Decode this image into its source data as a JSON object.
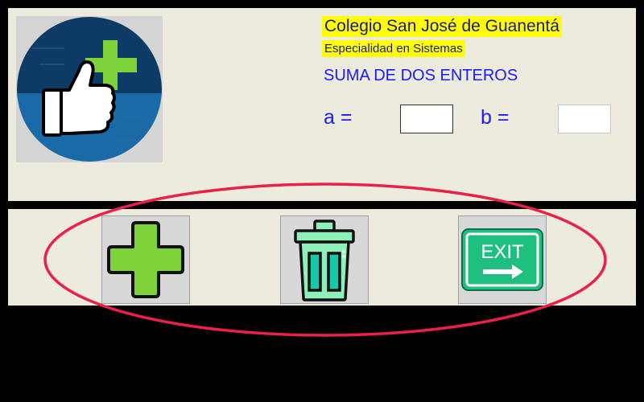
{
  "header": {
    "title": "Colegio San José de Guanentá",
    "subtitle": "Especialidad en Sistemas",
    "heading": "SUMA DE DOS ENTEROS"
  },
  "form": {
    "a_label": "a =",
    "a_value": "",
    "b_label": "b =",
    "b_value": ""
  },
  "toolbar": {
    "buttons": [
      {
        "icon": "plus-icon",
        "action": "sum"
      },
      {
        "icon": "trash-icon",
        "action": "clear"
      },
      {
        "icon": "exit-sign-icon",
        "text": "EXIT",
        "action": "exit"
      }
    ]
  },
  "colors": {
    "panel": "#ecebde",
    "background": "#000000",
    "title_highlight": "#ffff00",
    "title_text": "#1a1a8c",
    "label_text": "#1a1aff",
    "annotation": "#e8204a",
    "plus_green": "#7ed23a",
    "trash_teal": "#8ef0b8",
    "exit_green": "#1fbf7f"
  }
}
